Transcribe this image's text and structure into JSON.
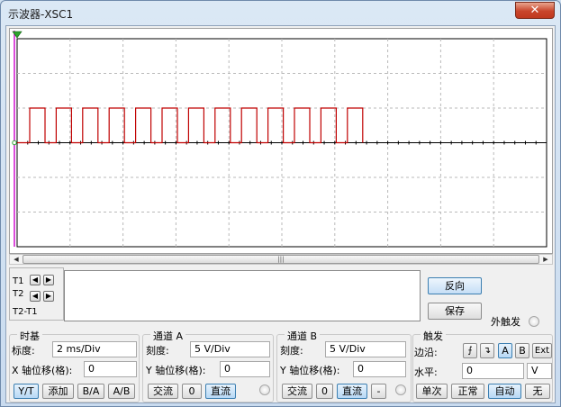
{
  "window": {
    "title": "示波器-XSC1",
    "close_label": "✕"
  },
  "colors": {
    "trace": "#c00000",
    "grid": "#b9b9b9",
    "trigger_marker": "#cc00cc"
  },
  "scope": {
    "signal": {
      "high_level_fraction_of_div": 1.0,
      "pulse_count": 13
    }
  },
  "cursors": {
    "t1": "T1",
    "t2": "T2",
    "t2_t1": "T2-T1"
  },
  "side_buttons": {
    "reverse": "反向",
    "save": "保存",
    "ext_trigger": "外触发"
  },
  "timebase": {
    "title": "时基",
    "scale_label": "标度:",
    "scale_value": "2 ms/Div",
    "xpos_label": "X 轴位移(格):",
    "xpos_value": "0",
    "modes": [
      "Y/T",
      "添加",
      "B/A",
      "A/B"
    ]
  },
  "channel_a": {
    "title": "通道 A",
    "scale_label": "刻度:",
    "scale_value": "5  V/Div",
    "ypos_label": "Y 轴位移(格):",
    "ypos_value": "0",
    "coupling": [
      "交流",
      "0",
      "直流"
    ]
  },
  "channel_b": {
    "title": "通道 B",
    "scale_label": "刻度:",
    "scale_value": "5  V/Div",
    "ypos_label": "Y 轴位移(格):",
    "ypos_value": "0",
    "coupling": [
      "交流",
      "0",
      "直流",
      "-"
    ]
  },
  "trigger": {
    "title": "触发",
    "edge_label": "边沿:",
    "edge_buttons": [
      "⨍",
      "↴",
      "A",
      "B",
      "Ext"
    ],
    "level_label": "水平:",
    "level_value": "0",
    "level_unit": "V",
    "modes": [
      "单次",
      "正常",
      "自动",
      "无"
    ]
  }
}
